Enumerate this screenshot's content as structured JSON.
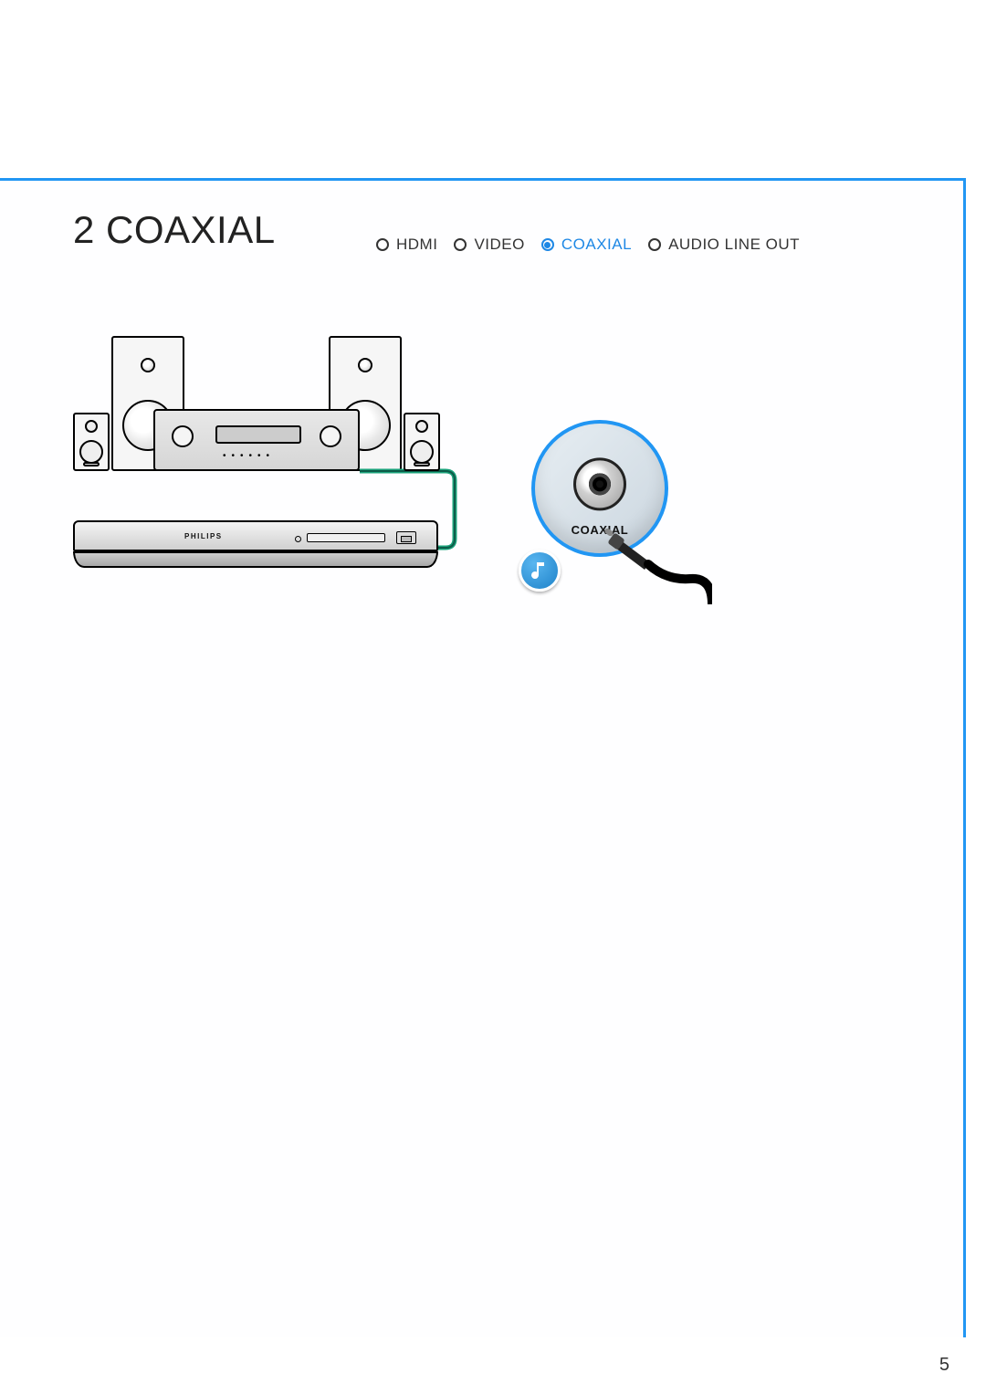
{
  "section": {
    "number": "2",
    "title": "COAXIAL"
  },
  "options": [
    {
      "key": "hdmi",
      "label": "HDMI",
      "selected": false
    },
    {
      "key": "video",
      "label": "VIDEO",
      "selected": false
    },
    {
      "key": "coaxial",
      "label": "COAXIAL",
      "selected": true
    },
    {
      "key": "audio",
      "label": "AUDIO LINE OUT",
      "selected": false
    }
  ],
  "callout": {
    "port_label": "COAXIAL"
  },
  "player": {
    "brand": "PHILIPS"
  },
  "page_number": "5",
  "colors": {
    "accent": "#2196f3",
    "accent_text": "#1e88e5"
  }
}
